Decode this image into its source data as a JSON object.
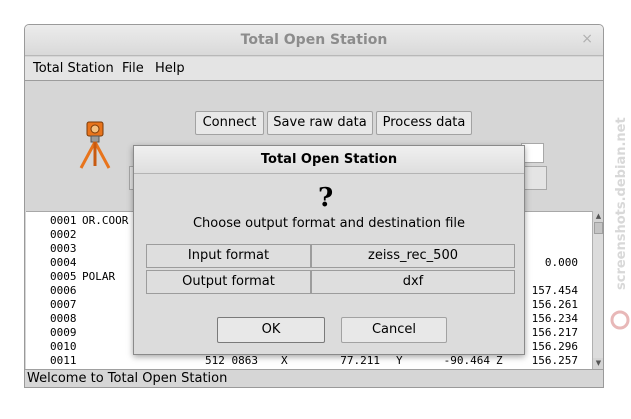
{
  "window": {
    "title": "Total Open Station",
    "close_glyph": "×"
  },
  "menu": [
    "Total Station",
    "File",
    "Help"
  ],
  "toolbar": {
    "connect": "Connect",
    "save_raw": "Save raw data",
    "process": "Process data"
  },
  "data_lines": [
    [
      "0001",
      "OR.COOR",
      "",
      "",
      "",
      "",
      "",
      "",
      ""
    ],
    [
      "0002",
      "",
      "",
      "",
      "",
      "",
      "",
      "",
      ""
    ],
    [
      "0003",
      "",
      "",
      "",
      "",
      "",
      "",
      "",
      ""
    ],
    [
      "0004",
      "",
      "",
      "",
      "",
      "",
      "",
      "",
      "0.000"
    ],
    [
      "0005",
      "POLAR",
      "",
      "",
      "",
      "",
      "",
      "",
      ""
    ],
    [
      "0006",
      "",
      "",
      "",
      "",
      "",
      "",
      "",
      "157.454"
    ],
    [
      "0007",
      "",
      "",
      "",
      "",
      "",
      "",
      "",
      "156.261"
    ],
    [
      "0008",
      "",
      "",
      "",
      "",
      "",
      "",
      "",
      "156.234"
    ],
    [
      "0009",
      "",
      "",
      "",
      "",
      "",
      "",
      "",
      "156.217"
    ],
    [
      "0010",
      "",
      "",
      "",
      "",
      "",
      "",
      "",
      "156.296"
    ],
    [
      "0011",
      "",
      "512 0863",
      "X",
      "77.211",
      "Y",
      "-90.464",
      "Z",
      "156.257"
    ]
  ],
  "status": "Welcome to Total Open Station",
  "dialog": {
    "title": "Total Open Station",
    "prompt": "Choose output format and destination file",
    "icon": "?",
    "rows": [
      {
        "label": "Input format",
        "value": "zeiss_rec_500"
      },
      {
        "label": "Output format",
        "value": "dxf"
      }
    ],
    "ok": "OK",
    "cancel": "Cancel"
  },
  "watermark": "screenshots.debian.net"
}
